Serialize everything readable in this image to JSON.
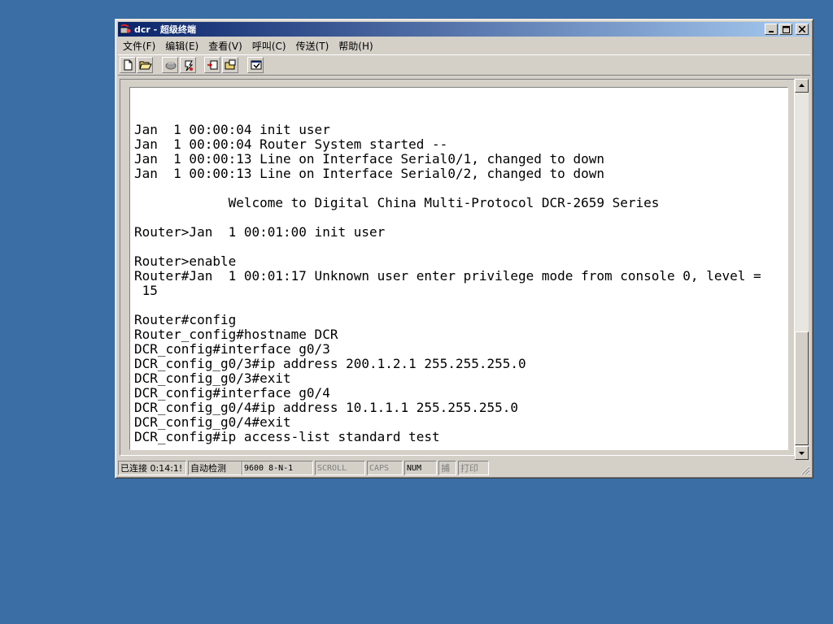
{
  "window": {
    "title": "dcr - 超级终端",
    "app_icon": "hyperterminal-icon",
    "buttons": {
      "minimize": "_",
      "maximize": "□",
      "close": "×"
    }
  },
  "menu": [
    {
      "label": "文件(F)"
    },
    {
      "label": "编辑(E)"
    },
    {
      "label": "查看(V)"
    },
    {
      "label": "呼叫(C)"
    },
    {
      "label": "传送(T)"
    },
    {
      "label": "帮助(H)"
    }
  ],
  "toolbar": {
    "icons": [
      "new-file-icon",
      "open-folder-icon",
      "dial-icon",
      "disconnect-icon",
      "send-file-icon",
      "receive-file-icon",
      "properties-icon"
    ]
  },
  "terminal": {
    "text": "Jan  1 00:00:04 init user\nJan  1 00:00:04 Router System started --\nJan  1 00:00:13 Line on Interface Serial0/1, changed to down\nJan  1 00:00:13 Line on Interface Serial0/2, changed to down\n\n            Welcome to Digital China Multi-Protocol DCR-2659 Series\n\nRouter>Jan  1 00:01:00 init user\n\nRouter>enable\nRouter#Jan  1 00:01:17 Unknown user enter privilege mode from console 0, level =\n 15\n\nRouter#config\nRouter_config#hostname DCR\nDCR_config#interface g0/3\nDCR_config_g0/3#ip address 200.1.2.1 255.255.255.0\nDCR_config_g0/3#exit\nDCR_config#interface g0/4\nDCR_config_g0/4#ip address 10.1.1.1 255.255.255.0\nDCR_config_g0/4#exit\nDCR_config#ip access-list standard test"
  },
  "status": {
    "connected": "已连接 0:14:1!",
    "detect": "自动检测",
    "port": "9600 8-N-1",
    "scroll": "SCROLL",
    "caps": "CAPS",
    "num": "NUM",
    "capture": "捕",
    "print": "打印"
  }
}
